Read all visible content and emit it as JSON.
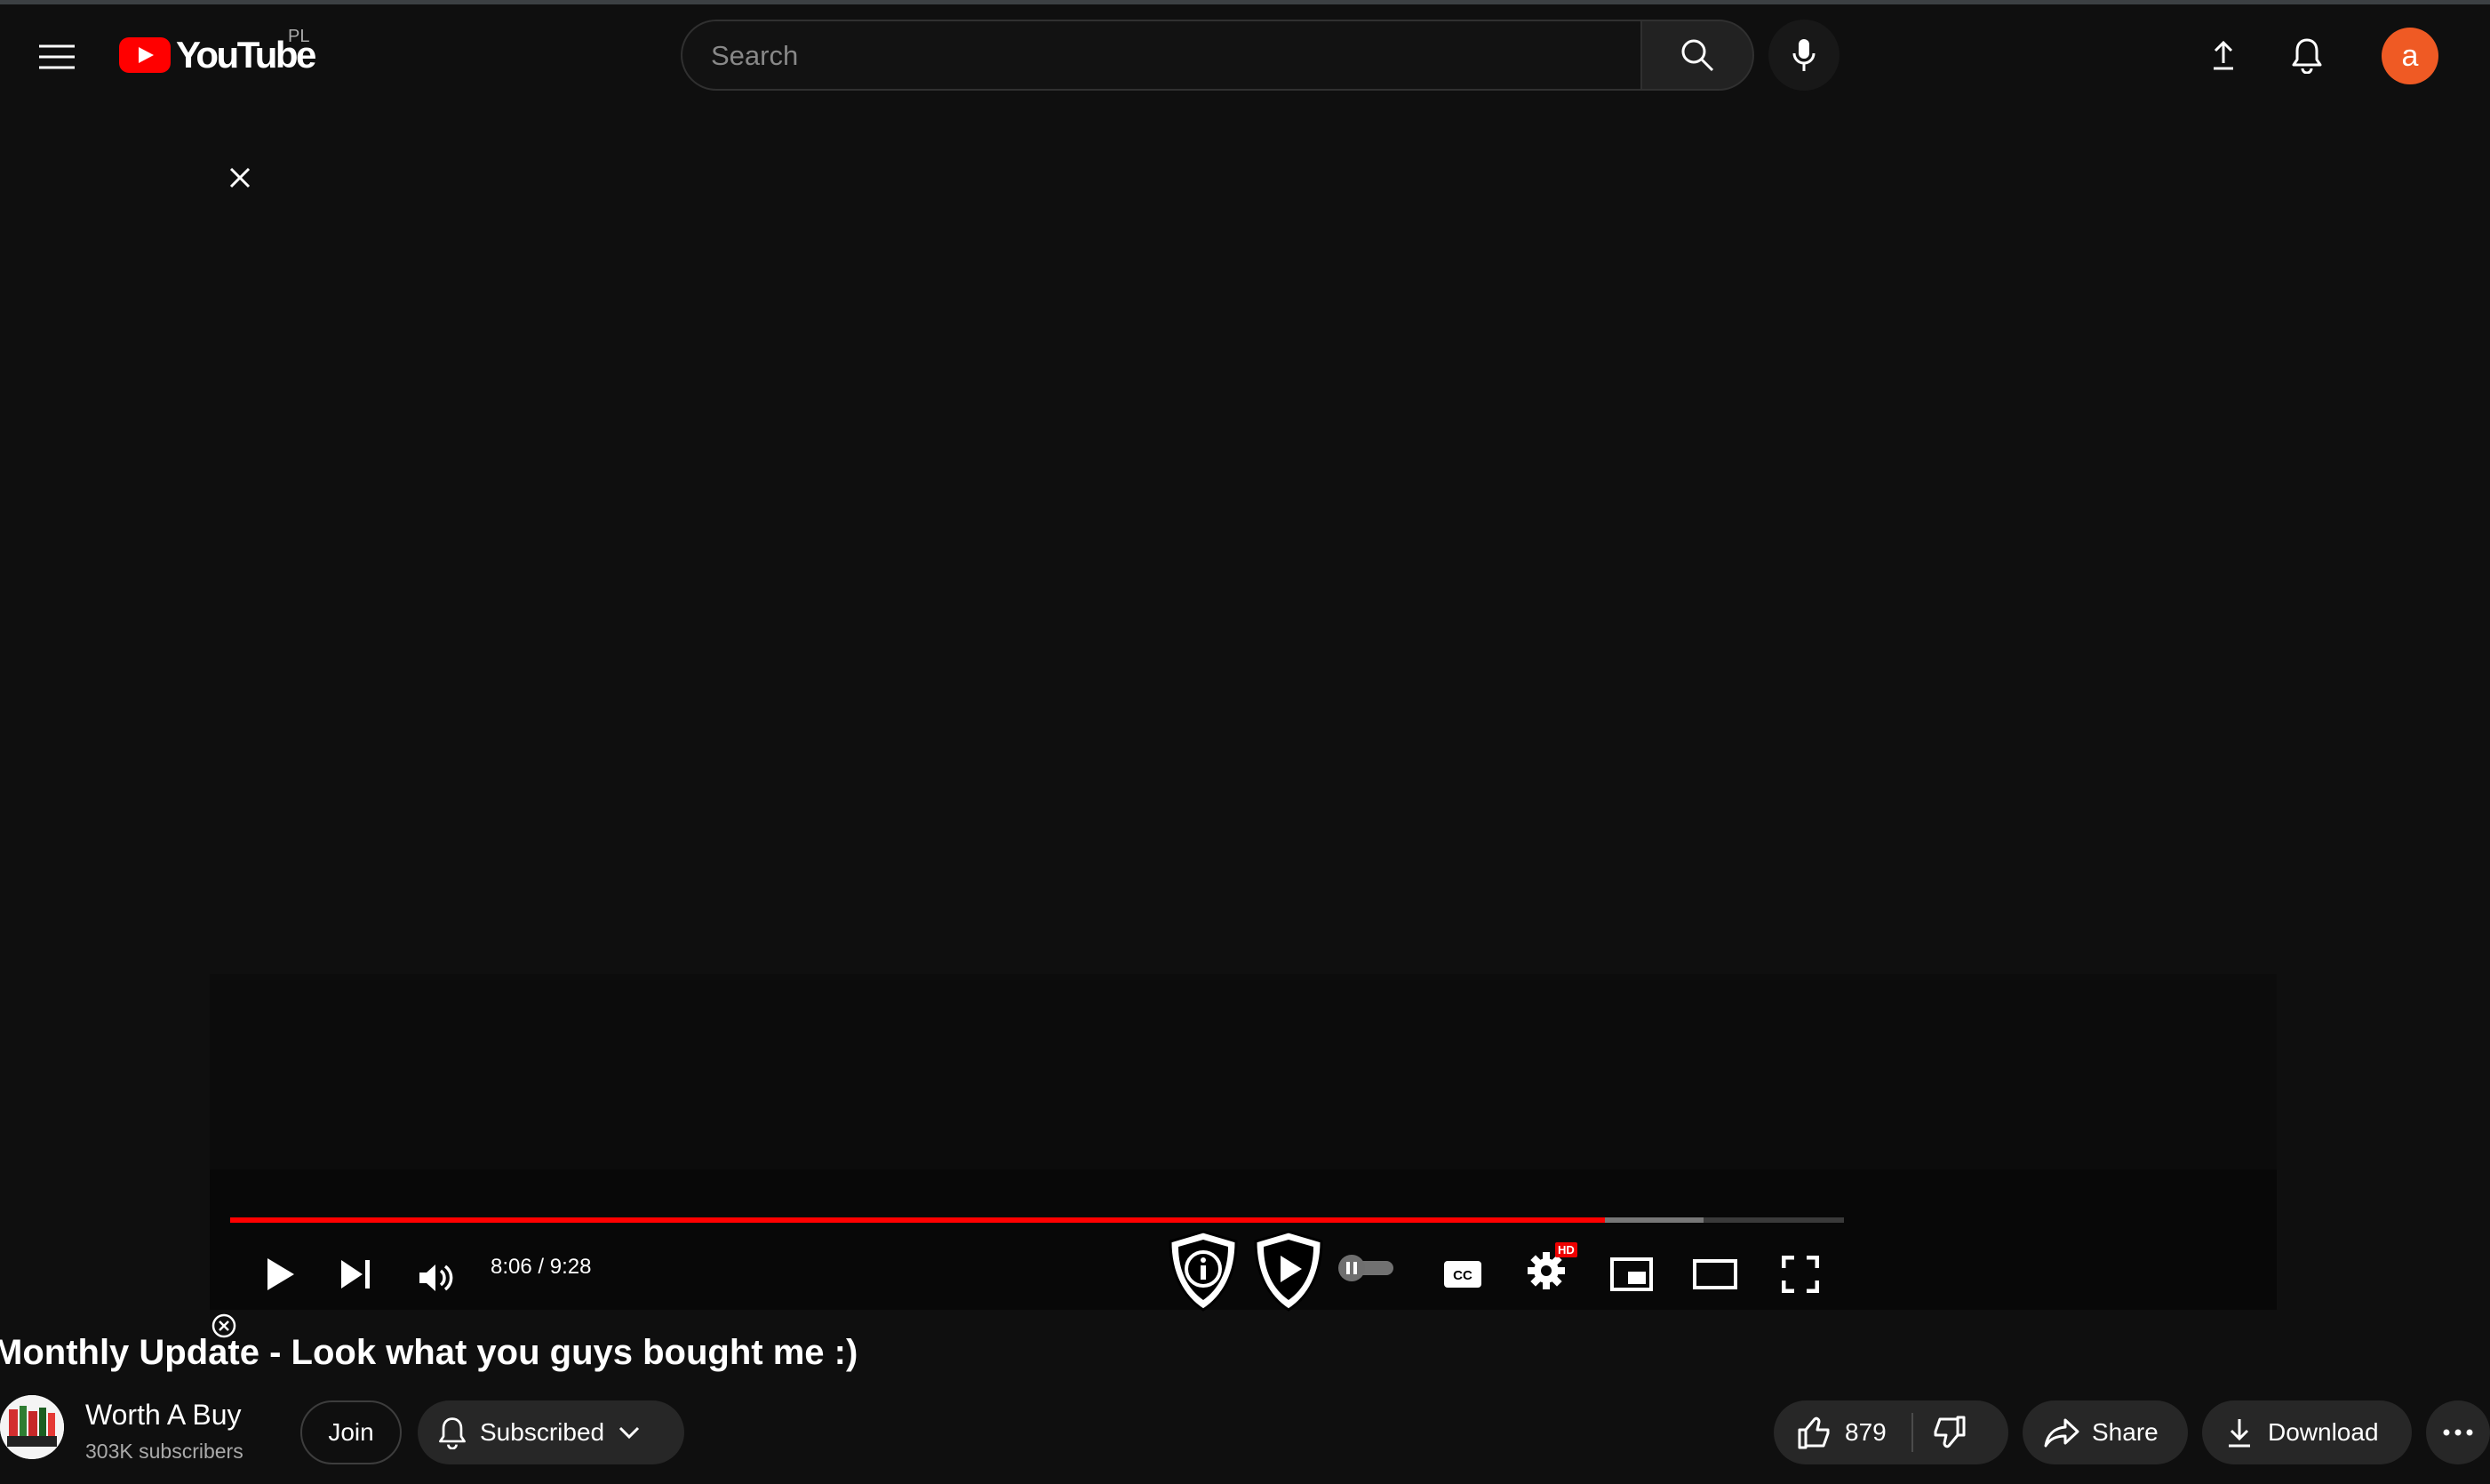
{
  "header": {
    "logo_text": "YouTube",
    "country_code": "PL",
    "search_placeholder": "Search",
    "avatar_letter": "a"
  },
  "player": {
    "time_display": "8:06 / 9:28",
    "progress_played_fraction": 0.852,
    "buffer_fraction": 0.913,
    "hd_badge": "HD"
  },
  "video": {
    "title": "Monthly Update - Look what you guys bought me :)",
    "channel_name": "Worth A Buy",
    "subscribers": "303K subscribers",
    "join_label": "Join",
    "subscribed_label": "Subscribed",
    "like_count": "879",
    "share_label": "Share",
    "download_label": "Download"
  },
  "colors": {
    "background": "#0f0f0f",
    "brand_red": "#ff0000",
    "avatar_orange": "#ef5a24",
    "pill_bg": "#272727"
  }
}
